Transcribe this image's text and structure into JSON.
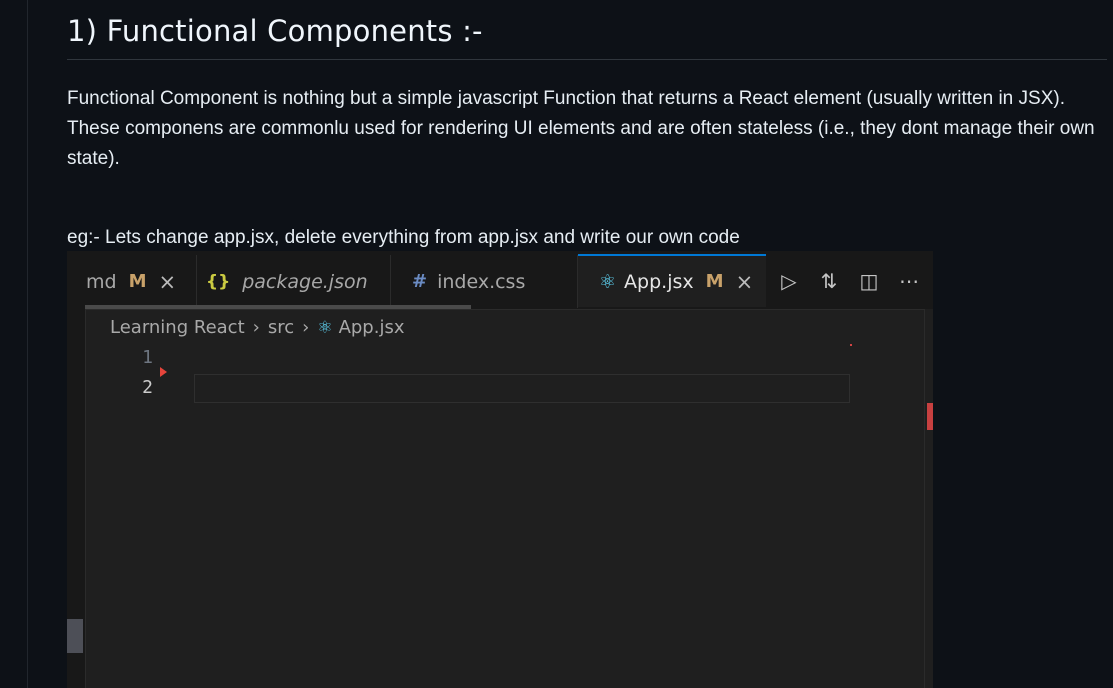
{
  "heading": "1) Functional Components :-",
  "paragraph": "Functional Component is nothing but a simple javascript Function that returns a React element (usually written in JSX). These componens are commonlu used for rendering UI elements and are often stateless (i.e., they dont manage their own state).",
  "example_caption": "eg:- Lets change app.jsx, delete everything from app.jsx and write our own code",
  "editor": {
    "tabs": [
      {
        "label": "md",
        "flag": "M",
        "close": "×",
        "active": false
      },
      {
        "label": "package.json",
        "icon": "{}",
        "active": false
      },
      {
        "label": "index.css",
        "icon": "#",
        "active": false
      },
      {
        "label": "App.jsx",
        "flag": "M",
        "close": "×",
        "icon": "react-icon",
        "active": true
      }
    ],
    "actions": [
      "run-icon",
      "compare-icon",
      "split-editor-icon",
      "more-icon"
    ],
    "breadcrumb": [
      "Learning React",
      "src",
      "App.jsx"
    ],
    "line_numbers": [
      "1",
      "2"
    ],
    "colors": {
      "accent": "#0078d4",
      "modified_flag": "#c9a26a",
      "json_icon": "#cbcb41",
      "css_icon": "#6b8cc4",
      "react_icon": "#61dafb",
      "error_marker": "#c74040"
    }
  }
}
